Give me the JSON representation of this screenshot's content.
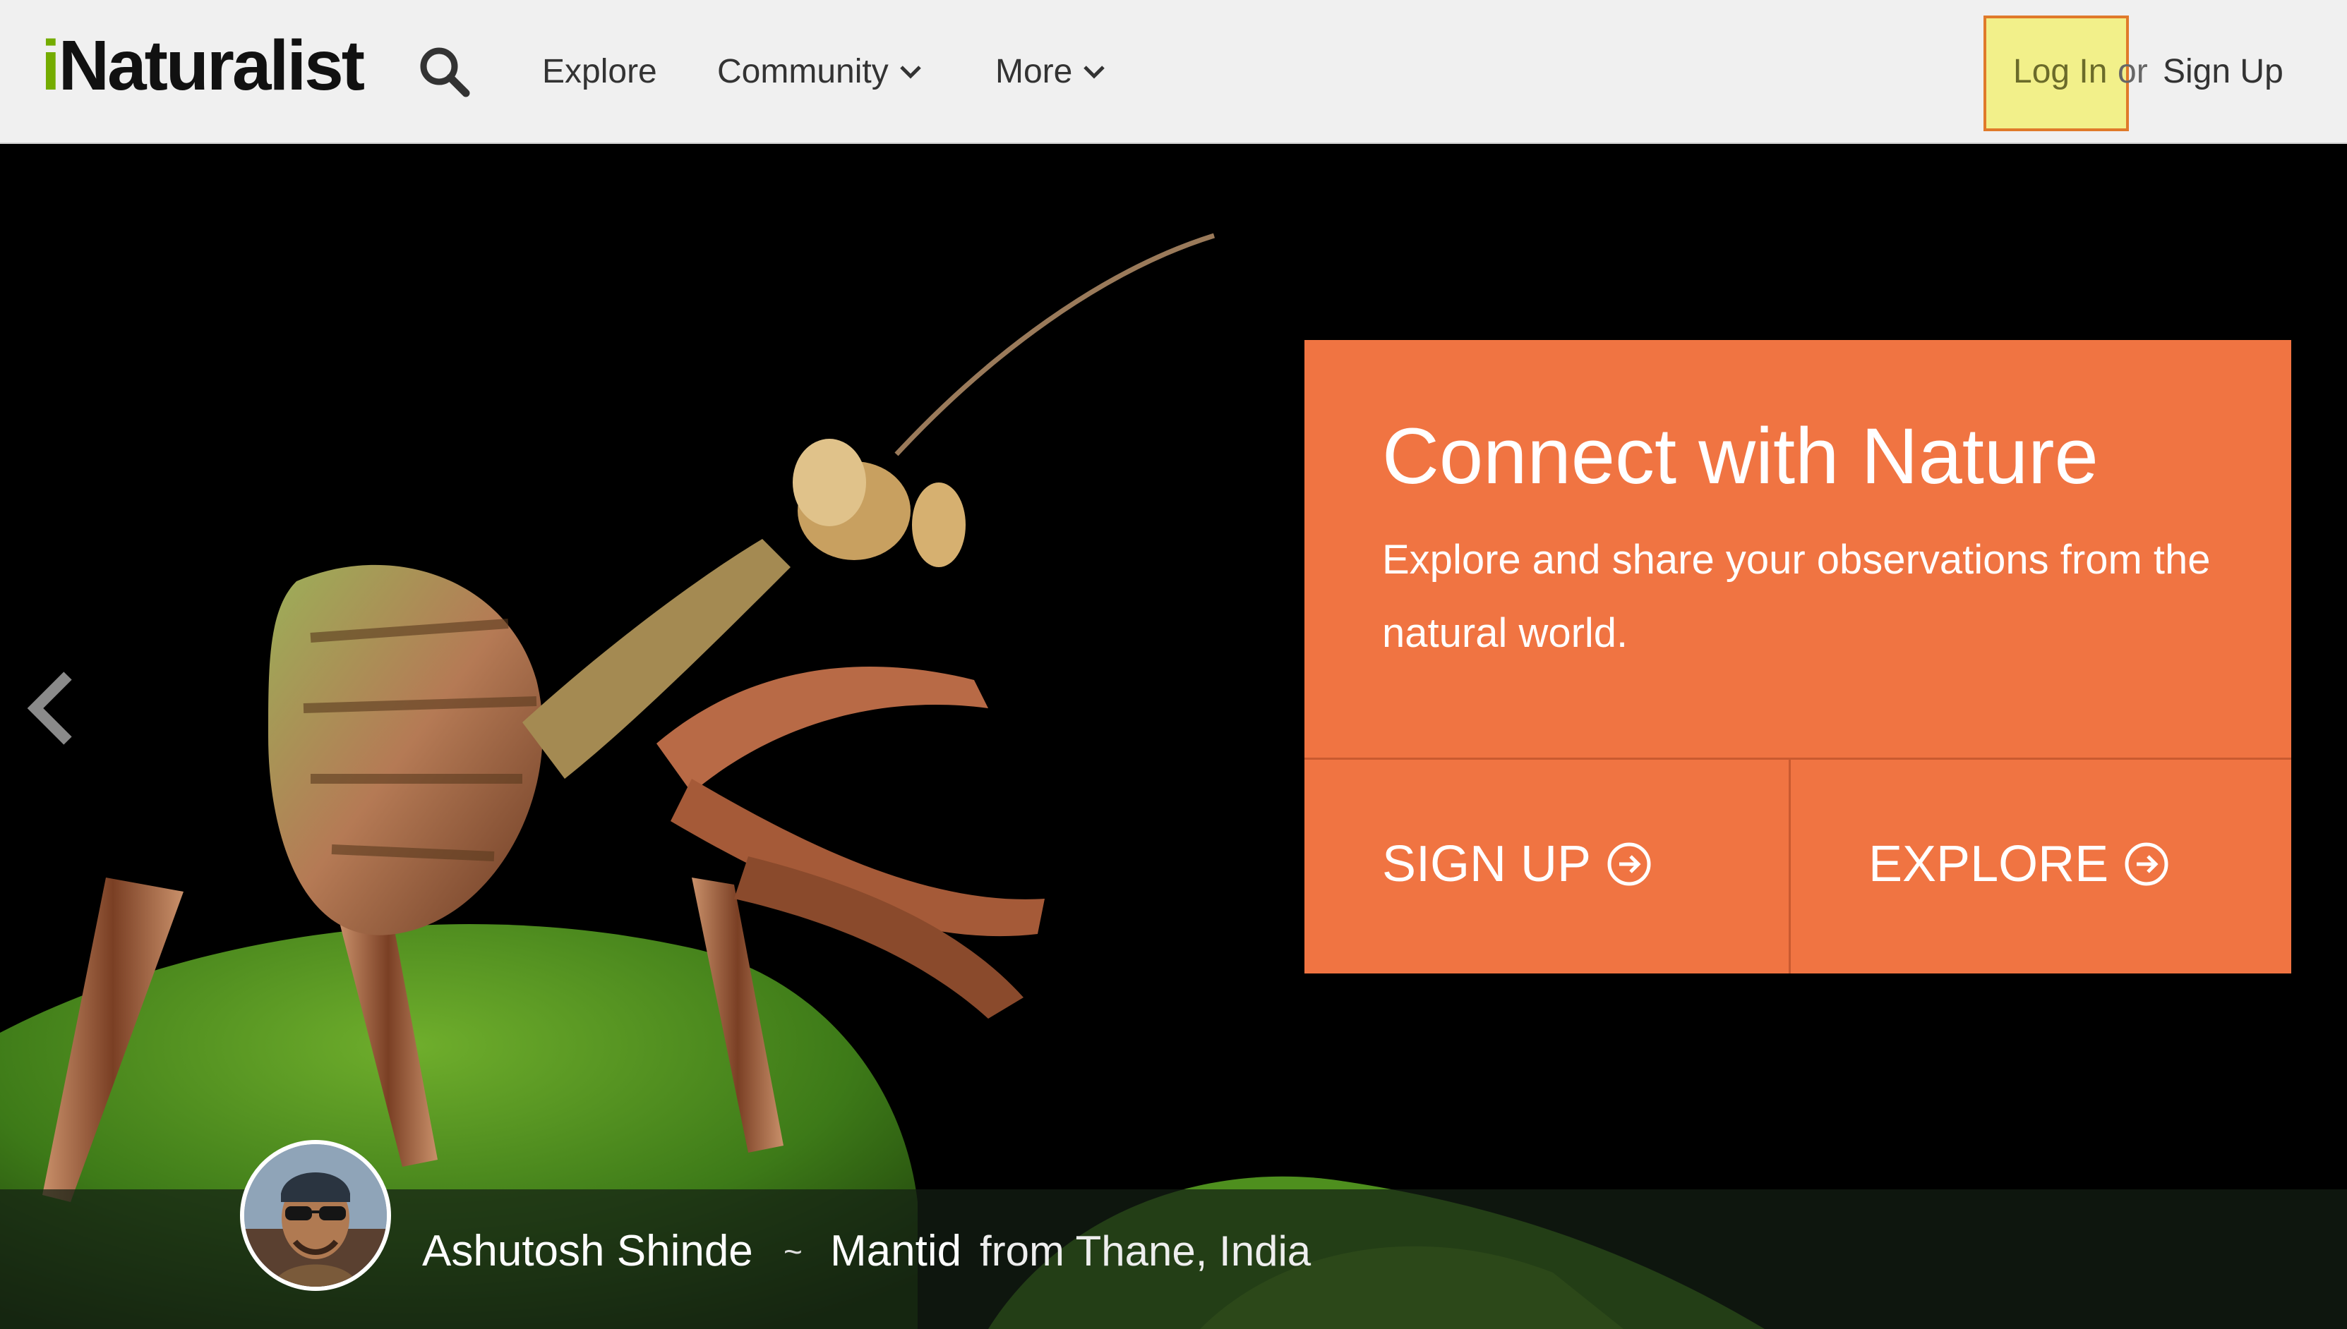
{
  "header": {
    "logo_prefix": "i",
    "logo_rest": "Naturalist",
    "nav": {
      "explore": "Explore",
      "community": "Community",
      "more": "More"
    },
    "auth": {
      "login": "Log In",
      "or": "or",
      "signup": "Sign Up"
    }
  },
  "hero": {
    "cta": {
      "title": "Connect with Nature",
      "subtitle": "Explore and share your observations from the natural world.",
      "signup_button": "SIGN UP",
      "explore_button": "EXPLORE"
    },
    "caption": {
      "author": "Ashutosh Shinde",
      "separator": "~",
      "species": "Mantid",
      "location": "from Thane, India"
    }
  },
  "colors": {
    "brand_green": "#74ac00",
    "cta_orange": "#f07442",
    "highlight_yellow": "#f2f08a",
    "highlight_border": "#e07a2a"
  },
  "icons": {
    "search": "search-icon",
    "chevron": "chevron-down-icon",
    "prev": "chevron-left-icon",
    "arrow_circle": "arrow-circle-right-icon"
  }
}
